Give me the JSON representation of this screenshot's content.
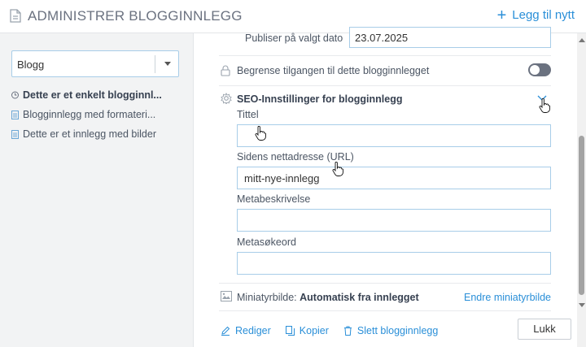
{
  "header": {
    "title": "ADMINISTRER BLOGGINNLEGG",
    "add_label": "Legg til nytt"
  },
  "sidebar": {
    "blog_select": "Blogg",
    "posts": [
      {
        "label": "Dette er et enkelt blogginnl...",
        "active": true
      },
      {
        "label": "Blogginnlegg med formateri...",
        "active": false
      },
      {
        "label": "Dette er et innlegg med bilder",
        "active": false
      }
    ]
  },
  "main": {
    "publish_label": "Publiser på valgt dato",
    "publish_date": "23.07.2025",
    "restrict_label": "Begrense tilgangen til dette blogginnlegget",
    "restrict_enabled": false,
    "seo": {
      "heading": "SEO-Innstillinger for blogginnlegg",
      "title_label": "Tittel",
      "title_value": "",
      "url_label": "Sidens nettadresse (URL)",
      "url_value": "mitt-nye-innlegg",
      "meta_desc_label": "Metabeskrivelse",
      "meta_desc_value": "",
      "meta_keywords_label": "Metasøkeord",
      "meta_keywords_value": ""
    },
    "thumbnail_label": "Miniatyrbilde: ",
    "thumbnail_value": "Automatisk fra innlegget",
    "thumbnail_change": "Endre miniatyrbilde",
    "actions": {
      "edit": "Rediger",
      "copy": "Kopier",
      "delete": "Slett blogginnlegg"
    },
    "close": "Lukk"
  },
  "colors": {
    "accent": "#2a8fd8",
    "input_border": "#a8cde8",
    "sidebar_bg": "#f2f3f4",
    "toggle_off": "#6b7280"
  }
}
